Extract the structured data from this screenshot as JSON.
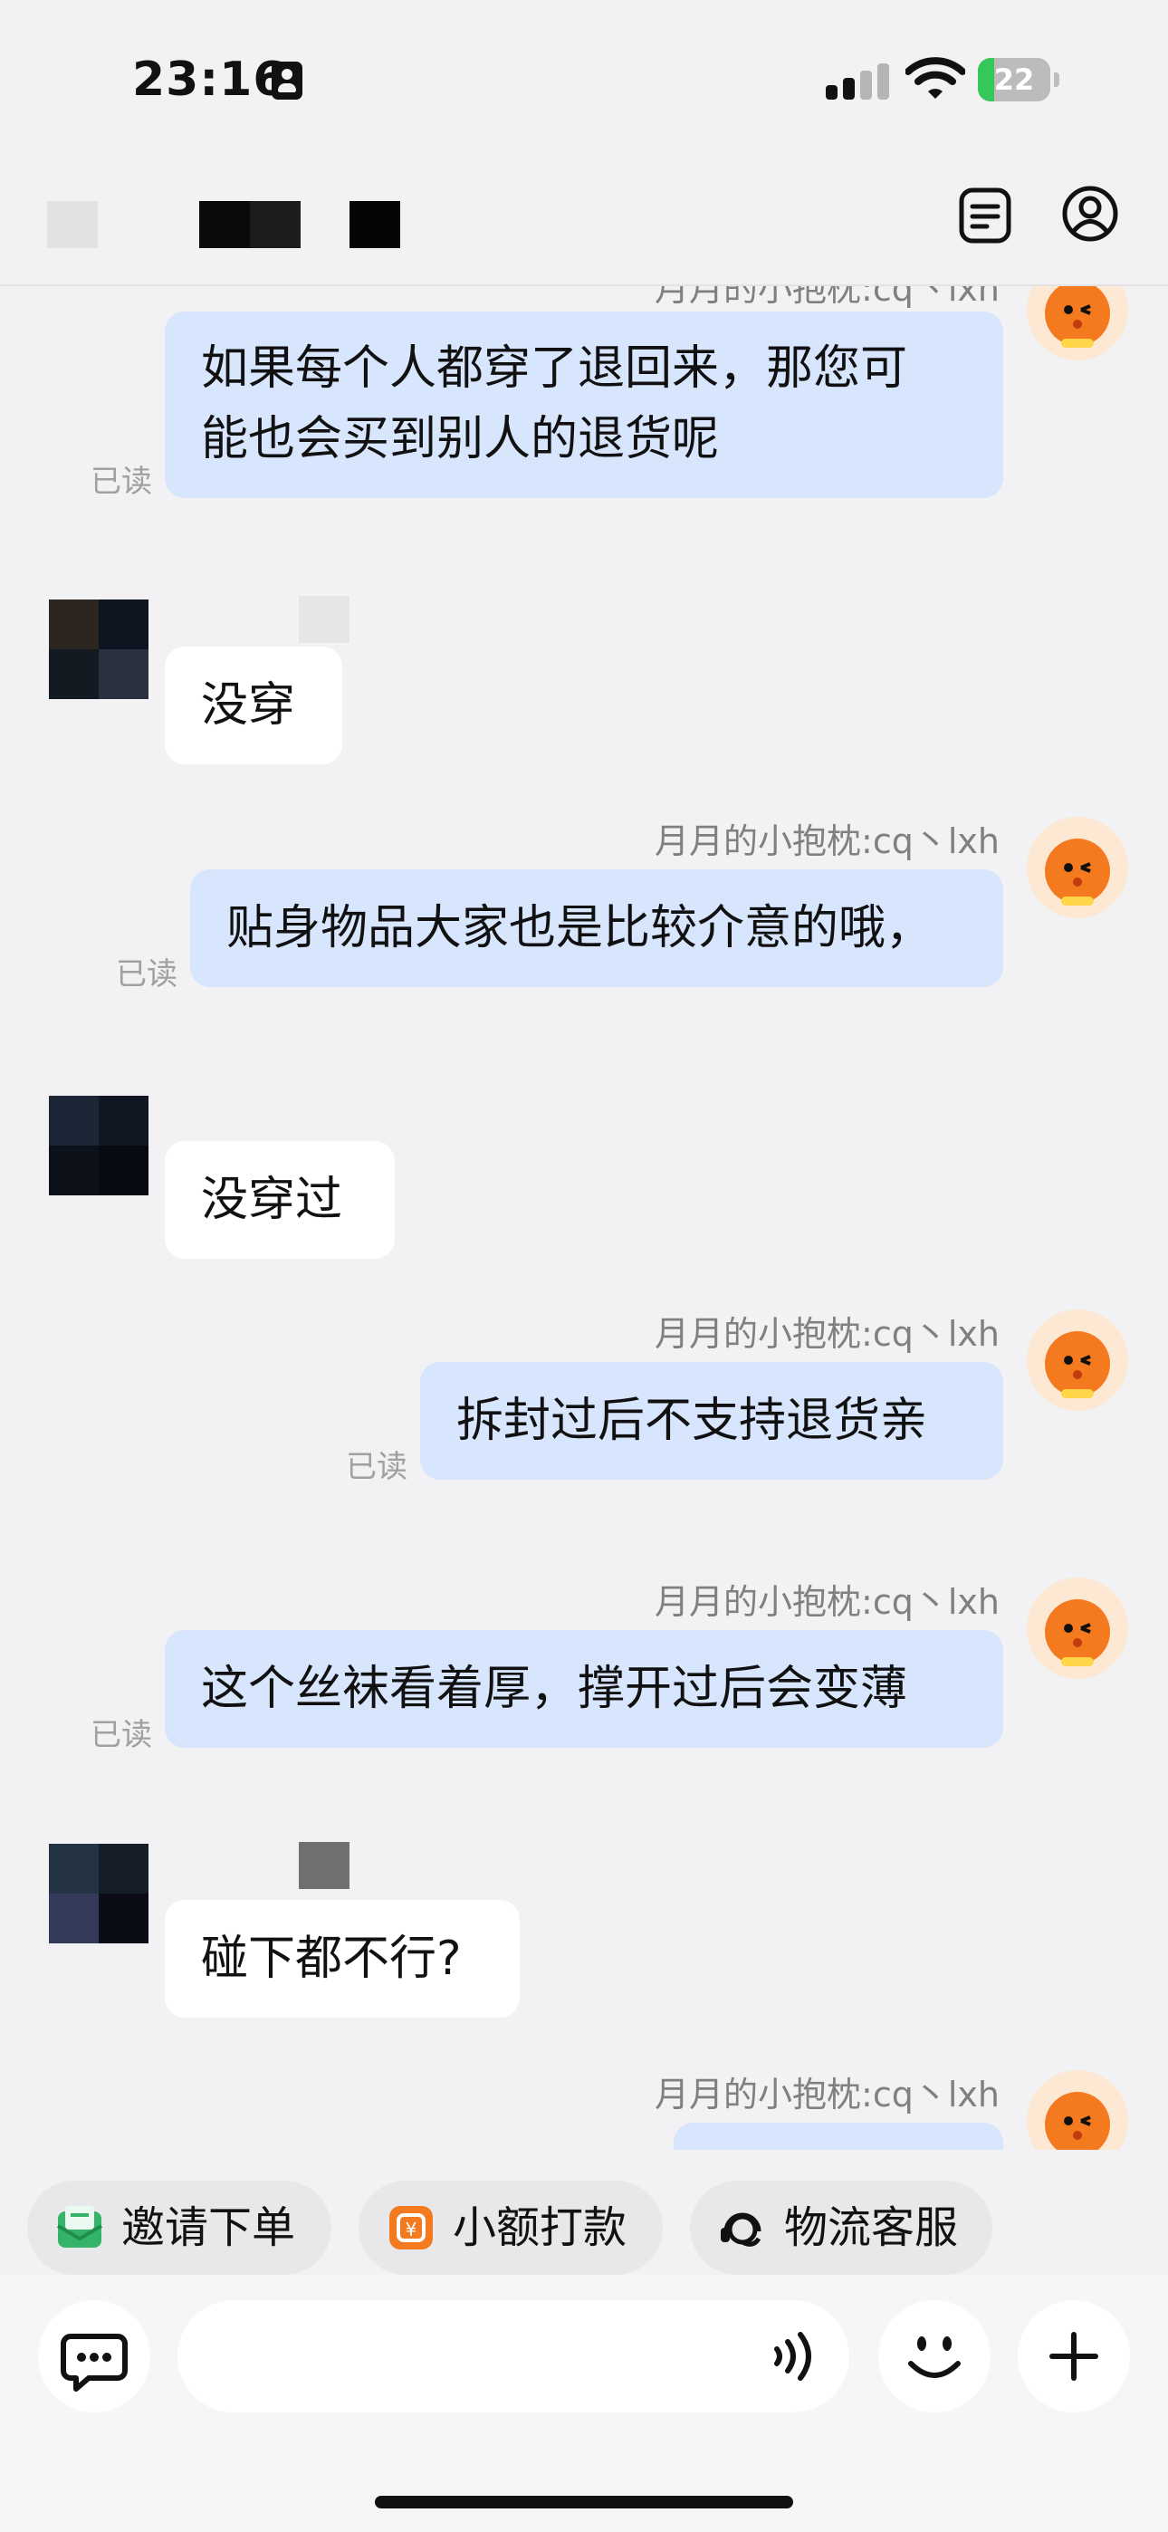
{
  "status_bar": {
    "time": "23:16",
    "battery": "22",
    "battery_level": 0.22
  },
  "messages": [
    {
      "type": "out",
      "text_lines": [
        "如果每个人都穿了退回来，那您可",
        "能也会买到别人的退货呢"
      ],
      "read": "已读",
      "sender": "月月的小抱枕:cq丶lxh"
    },
    {
      "type": "in",
      "text": "没穿"
    },
    {
      "type": "out",
      "text": "贴身物品大家也是比较介意的哦，",
      "read": "已读",
      "sender": "月月的小抱枕:cq丶lxh"
    },
    {
      "type": "in",
      "text": "没穿过"
    },
    {
      "type": "out",
      "text": "拆封过后不支持退货亲",
      "read": "已读",
      "sender": "月月的小抱枕:cq丶lxh"
    },
    {
      "type": "out",
      "text": "这个丝袜看着厚，撑开过后会变薄",
      "read": "已读",
      "sender": "月月的小抱枕:cq丶lxh"
    },
    {
      "type": "in",
      "text": "碰下都不行?"
    },
    {
      "type": "out",
      "text": "",
      "sender": "月月的小抱枕:cq丶lxh"
    }
  ],
  "quick_actions": [
    {
      "label": "邀请下单",
      "icon": "invite-order-icon"
    },
    {
      "label": "小额打款",
      "icon": "small-payment-icon"
    },
    {
      "label": "物流客服",
      "icon": "logistics-service-icon"
    }
  ],
  "input": {
    "placeholder": ""
  },
  "icons": {
    "header_right": [
      "order-list-icon",
      "profile-icon"
    ],
    "input_bar": [
      "quick-reply-icon",
      "voice-icon",
      "emoji-icon",
      "plus-icon"
    ]
  },
  "colors": {
    "outgoing_bubble": "#d7e5fd",
    "incoming_bubble": "#ffffff",
    "background": "#f2f2f4",
    "read_text": "#a0a0a0"
  }
}
